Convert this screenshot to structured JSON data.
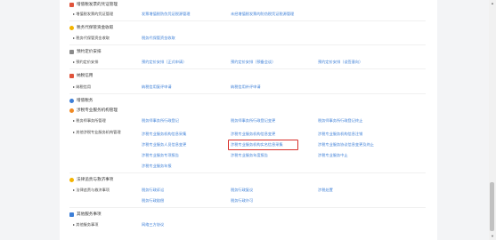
{
  "colors": {
    "link": "#3d7fd7",
    "highlight_border": "#d8302b",
    "icon_red": "#e0533b",
    "icon_yellow": "#f4b400",
    "icon_blue": "#3d7fd7",
    "icon_orange": "#f08a24",
    "icon_gray": "#8a8a8a"
  },
  "sections": {
    "s1": {
      "title": "增值税发票的凭证管理",
      "icon": "doc-icon"
    },
    "s2": {
      "title": "税务代保管资金收取",
      "icon": "star-icon"
    },
    "s3": {
      "title": "预约定价安排",
      "icon": "calendar-icon"
    },
    "s4": {
      "title": "纳税信用",
      "icon": "credit-icon"
    },
    "s5": {
      "title": "增值税务",
      "icon": "circle-icon"
    },
    "s6": {
      "title": "涉税专业服务机构管理",
      "icon": "gear-icon"
    },
    "s7": {
      "title": "法律追责与救济事项",
      "icon": "heart-icon"
    },
    "s8": {
      "title": "其他服务事项",
      "icon": "list-icon"
    }
  },
  "subs": {
    "s1": "▸ 增值税发票的凭证管理",
    "s2": "▸ 税务代保管资金收取",
    "s3": "▸ 预约定价安排",
    "s4": "▸ 纳税信用",
    "s6a": "▸ 税务师事务所管理",
    "s6b": "▸ 其他涉税专业服务机构管理",
    "s7": "▸ 法律追责与救济事项",
    "s8": "▸ 其他服务事项"
  },
  "links": {
    "s1": [
      "发票增值税防伪凭证税源管理",
      "未经增值税发票的防伪税凭证税源管理"
    ],
    "s2": [
      "税务代保管资金收取"
    ],
    "s3": [
      "预约定价安排（正式申请）",
      "预约定价安排（预备会谈）",
      "预约定价安排（谈签意向）"
    ],
    "s4": [
      "纳税信用复评申请",
      "纳税信用补评申请"
    ],
    "s6a": [
      "税务师事务所行政登记",
      "税务师事务所行政登记变更",
      "税务师事务所行政登记终止"
    ],
    "s6b_col1": [
      "涉税专业服务机构信息采集",
      "涉税专业服务人员信息变更",
      "涉税专业服务专项报告",
      "涉税专业服务年报"
    ],
    "s6b_col2": [
      "涉税专业服务机构信息变更",
      "涉税专业服务机构实名信息采集",
      "涉税专业服务年度报告"
    ],
    "s6b_col3": [
      "涉税专业服务机构信息注销",
      "涉税专业服务协议信息变更及终止",
      "涉税专业服务中止"
    ],
    "s7": [
      "税务行政诉讼",
      "税务行政复议",
      "税务行政赔偿",
      "税务行政许可",
      "涉税处置"
    ],
    "s8": [
      "网络三方协议"
    ]
  }
}
